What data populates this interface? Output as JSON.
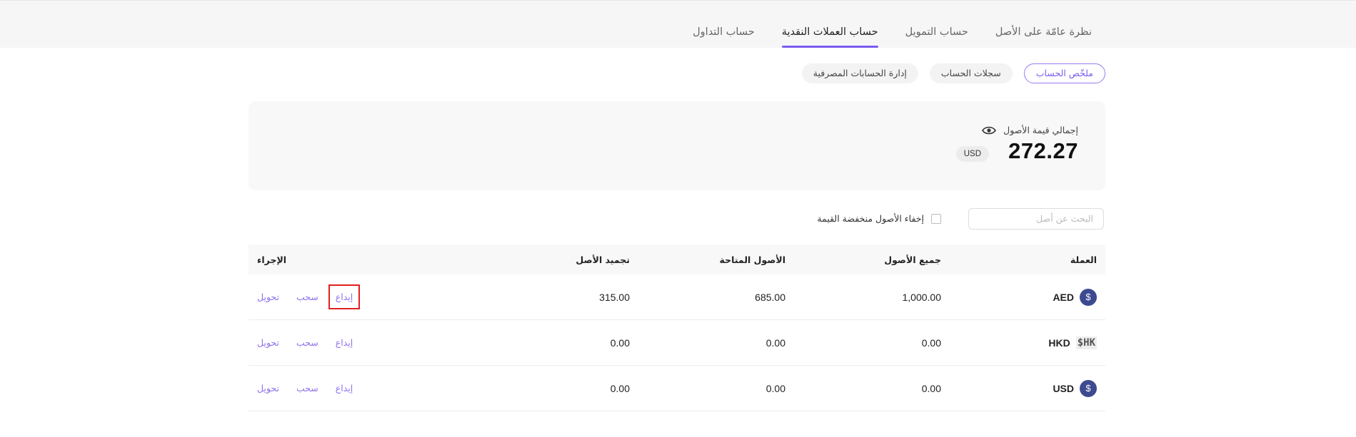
{
  "tabs": [
    {
      "label": "نظرة عامّة على الأصل",
      "active": false
    },
    {
      "label": "حساب التمويل",
      "active": false
    },
    {
      "label": "حساب العملات النقدية",
      "active": true
    },
    {
      "label": "حساب التداول",
      "active": false
    }
  ],
  "subtabs": [
    {
      "label": "ملخّص الحساب",
      "active": true
    },
    {
      "label": "سجلات الحساب",
      "active": false
    },
    {
      "label": "إدارة الحسابات المصرفية",
      "active": false
    }
  ],
  "summary": {
    "label": "إجمالي قيمة الأصول",
    "value": "272.27",
    "currency": "USD"
  },
  "filters": {
    "search_placeholder": "البحث عن أصل",
    "hide_small_label": "إخفاء الأصول منخفضة القيمة"
  },
  "table": {
    "headers": {
      "currency": "العملة",
      "total": "جميع الأصول",
      "available": "الأصول المتاحة",
      "frozen": "تجميد الأصل",
      "action": "الإجراء"
    },
    "actions": {
      "deposit": "إيداع",
      "withdraw": "سحب",
      "transfer": "تحويل"
    },
    "rows": [
      {
        "code": "AED",
        "icon": "$",
        "total": "1,000.00",
        "available": "685.00",
        "frozen": "315.00"
      },
      {
        "code": "HKD",
        "icon": "HK$",
        "total": "0.00",
        "available": "0.00",
        "frozen": "0.00"
      },
      {
        "code": "USD",
        "icon": "$",
        "total": "0.00",
        "available": "0.00",
        "frozen": "0.00"
      }
    ]
  },
  "colors": {
    "accent": "#7b5cf0",
    "coin_icon": "#3d4a8f",
    "highlight": "#e02020"
  }
}
